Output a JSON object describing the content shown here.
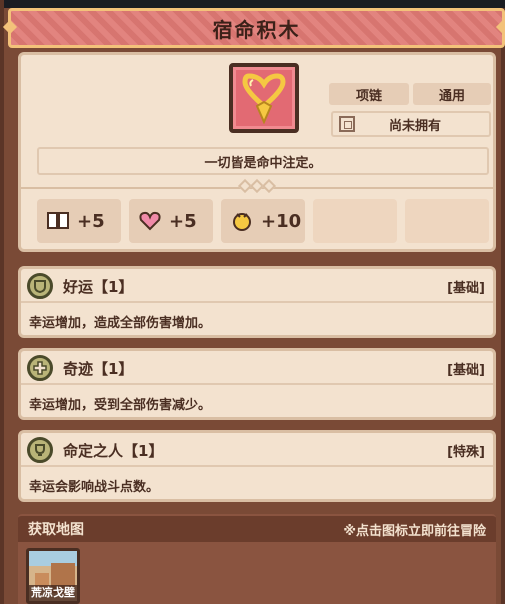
{
  "item": {
    "title": "宿命积木",
    "icon": "golden-heart-necklace-icon",
    "tag_type": "项链",
    "tag_scope": "通用",
    "owned_status": "尚未拥有",
    "quote": "一切皆是命中注定。"
  },
  "stats": [
    {
      "icon": "book-icon",
      "value": "+5"
    },
    {
      "icon": "heart-icon",
      "value": "+5"
    },
    {
      "icon": "clover-icon",
      "value": "+10"
    }
  ],
  "effects": [
    {
      "icon": "luck-shield-icon",
      "name": "好运【1】",
      "type": "[基础]",
      "desc": "幸运增加，造成全部伤害增加。"
    },
    {
      "icon": "cross-plus-icon",
      "name": "奇迹【1】",
      "type": "[基础]",
      "desc": "幸运增加，受到全部伤害减少。"
    },
    {
      "icon": "destiny-cup-icon",
      "name": "命定之人【1】",
      "type": "[特殊]",
      "desc": "幸运会影响战斗点数。"
    }
  ],
  "map": {
    "header": "获取地图",
    "hint": "※点击图标立即前往冒险",
    "locations": [
      {
        "name": "荒凉戈壁"
      }
    ]
  },
  "colors": {
    "banner": "#e07a74",
    "panel": "#f3e2cf",
    "frame": "#7a4a36",
    "accent_gold": "#f3c27a"
  }
}
